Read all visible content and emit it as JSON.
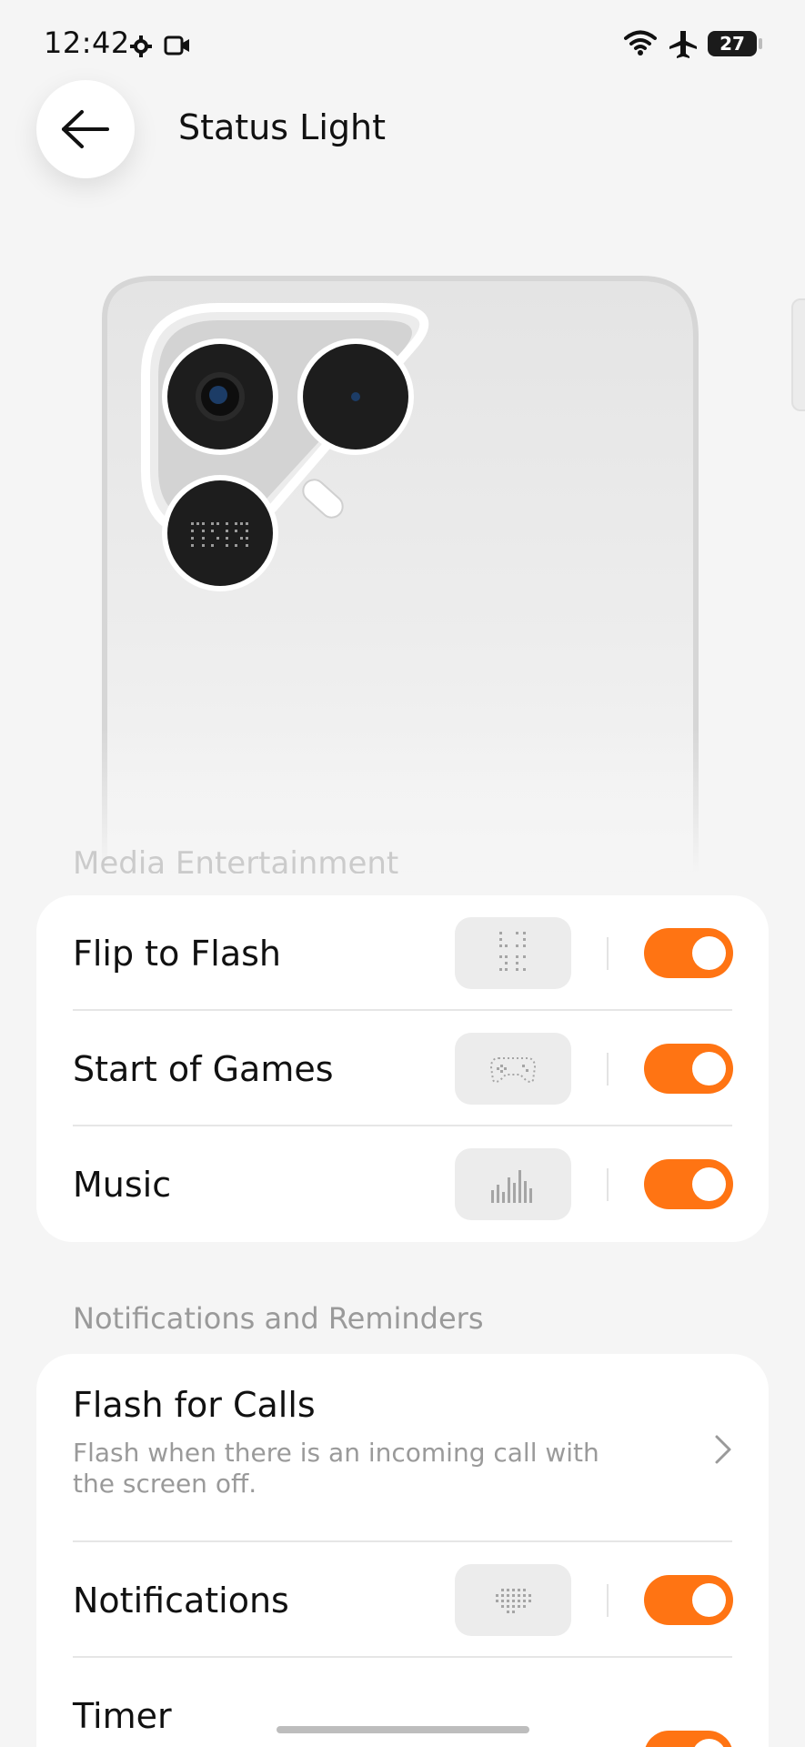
{
  "status_bar": {
    "time": "12:42",
    "battery": "27",
    "icons": [
      "gear-icon",
      "video-icon",
      "wifi-icon",
      "airplane-icon",
      "battery-icon"
    ]
  },
  "header": {
    "title": "Status Light",
    "back_icon": "arrow-left-icon"
  },
  "faded_section_label": "Media Entertainment",
  "media_items": [
    {
      "label": "Flip to Flash",
      "enabled": true,
      "preview_icon": "glyph-pattern-icon"
    },
    {
      "label": "Start of Games",
      "enabled": true,
      "preview_icon": "gamepad-dots-icon"
    },
    {
      "label": "Music",
      "enabled": true,
      "preview_icon": "equalizer-dots-icon"
    }
  ],
  "notifications_section": {
    "title": "Notifications and Reminders",
    "flash_for_calls": {
      "title": "Flash for Calls",
      "description": "Flash when there is an incoming call with the screen off."
    },
    "items": [
      {
        "label": "Notifications",
        "enabled": true,
        "preview_icon": "bubble-dots-icon"
      },
      {
        "label": "Timer",
        "enabled": true
      }
    ]
  },
  "colors": {
    "accent": "#ff7413",
    "background": "#f5f5f5",
    "card": "#ffffff",
    "secondary_text": "#9a9a9a"
  }
}
